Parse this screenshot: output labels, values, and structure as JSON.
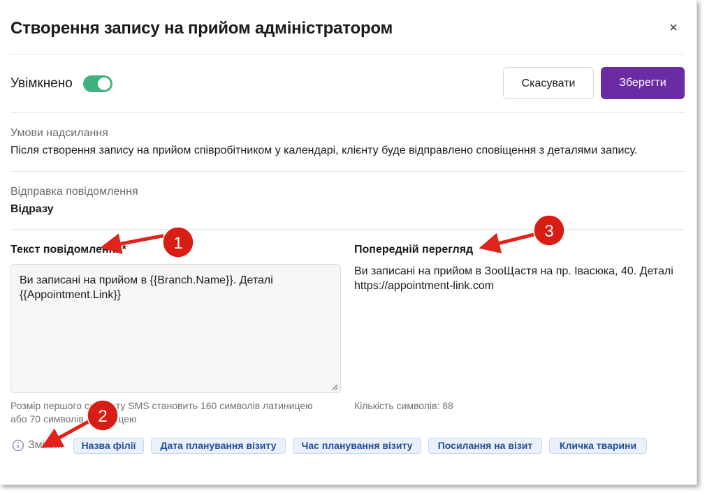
{
  "dialog": {
    "title": "Створення запису на прийом адміністратором",
    "close_symbol": "×"
  },
  "header": {
    "enabled_label": "Увімкнено",
    "toggle_on": true,
    "cancel_label": "Скасувати",
    "save_label": "Зберегти"
  },
  "conditions": {
    "label": "Умови надсилання",
    "text": "Після створення запису на прийом співробітником у календарі, клієнту буде відправлено сповіщення з деталями запису."
  },
  "sending": {
    "label": "Відправка повідомлення",
    "value": "Відразу"
  },
  "message": {
    "label": "Текст повідомлення*",
    "value": "Ви записані на прийом в {{Branch.Name}}. Деталі {{Appointment.Link}}",
    "hint_line1": "Розмір першого сегменту SMS становить 160 символів латиницею",
    "hint_line2": "або 70 символів кирилицею"
  },
  "preview": {
    "label": "Попередній перегляд",
    "text": "Ви записані на прийом в ЗооЩастя на пр. Івасюка, 40. Деталі https://appointment-link.com",
    "char_count": "Кількість символів: 88"
  },
  "variables": {
    "label": "Змінні:",
    "chips": [
      "Назва філії",
      "Дата планування візиту",
      "Час планування візиту",
      "Посилання на візит",
      "Кличка тварини"
    ]
  },
  "annotations": {
    "badges": [
      "1",
      "2",
      "3"
    ],
    "color": "#e0241b"
  },
  "colors": {
    "accent": "#6a2ba4",
    "toggle": "#3fb37f",
    "chip_bg": "#eaf1fc",
    "chip_text": "#1f4f96"
  },
  "icons": [
    "close-icon",
    "info-icon",
    "resize-handle-icon"
  ]
}
